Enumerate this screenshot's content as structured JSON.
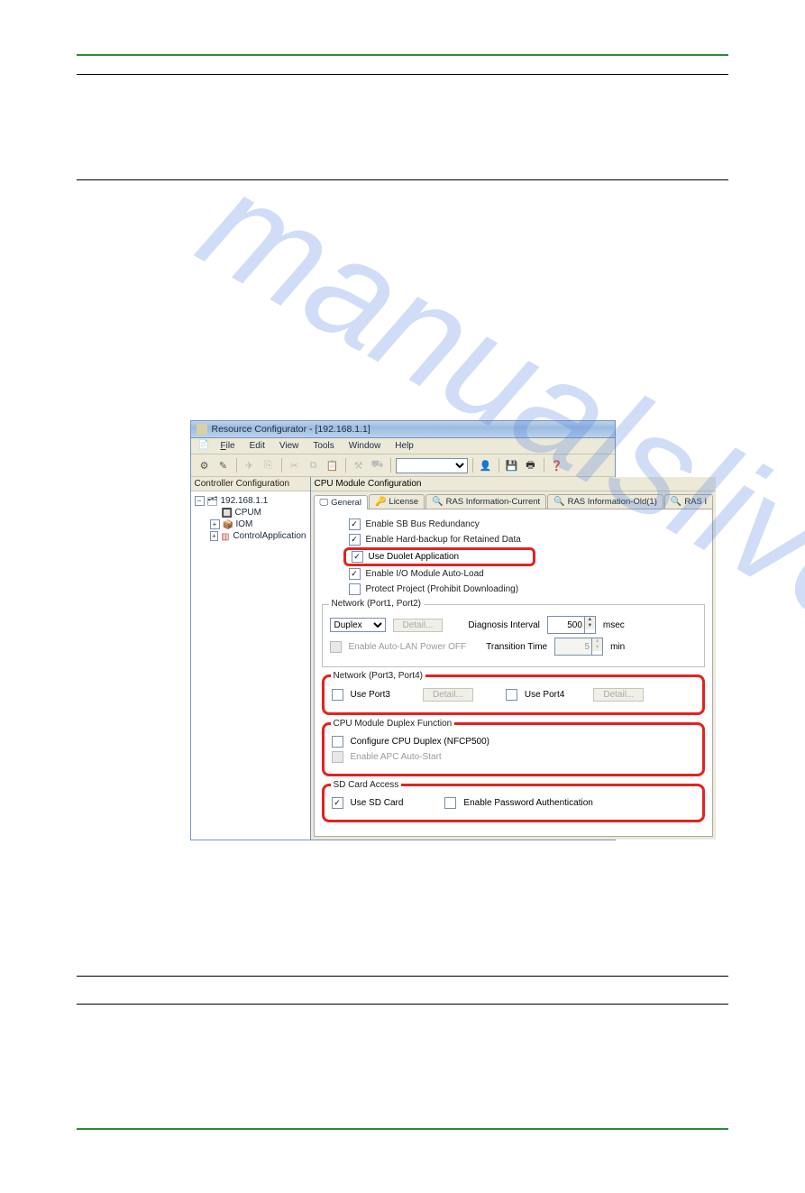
{
  "titlebar": {
    "text": "Resource Configurator - [192.168.1.1]"
  },
  "menubar": {
    "file": "File",
    "edit": "Edit",
    "view": "View",
    "tools": "Tools",
    "window": "Window",
    "help": "Help"
  },
  "toolbar": {
    "select_placeholder": ""
  },
  "left_pane": {
    "title": "Controller Configuration",
    "root": "192.168.1.1",
    "cpum": "CPUM",
    "iom": "IOM",
    "control_app": "ControlApplication"
  },
  "right_pane": {
    "title": "CPU Module Configuration",
    "tabs": {
      "general": "General",
      "license": "License",
      "ras_current": "RAS Information-Current",
      "ras_old": "RAS Information-Old(1)",
      "ras_trunc": "RAS I"
    }
  },
  "general": {
    "enable_sb_bus": "Enable SB Bus Redundancy",
    "enable_hard_backup": "Enable Hard-backup for Retained Data",
    "use_duolet": "Use Duolet Application",
    "enable_io_autoload": "Enable I/O Module Auto-Load",
    "protect_project": "Protect Project (Prohibit Downloading)"
  },
  "network12": {
    "legend": "Network (Port1, Port2)",
    "duplex": "Duplex",
    "detail_btn": "Detail...",
    "enable_auto_lan": "Enable Auto-LAN Power OFF",
    "diag_interval_label": "Diagnosis Interval",
    "diag_interval_value": "500",
    "diag_unit": "msec",
    "transition_label": "Transition Time",
    "transition_value": "5",
    "transition_unit": "min"
  },
  "network34": {
    "legend": "Network (Port3, Port4)",
    "use_port3": "Use Port3",
    "detail3": "Detail...",
    "use_port4": "Use Port4",
    "detail4": "Detail..."
  },
  "duplex_fn": {
    "legend": "CPU Module Duplex Function",
    "configure": "Configure CPU Duplex (NFCP500)",
    "apc_autostart": "Enable APC Auto-Start"
  },
  "sdcard": {
    "legend": "SD Card Access",
    "use_sd": "Use SD Card",
    "enable_pw": "Enable Password Authentication"
  }
}
